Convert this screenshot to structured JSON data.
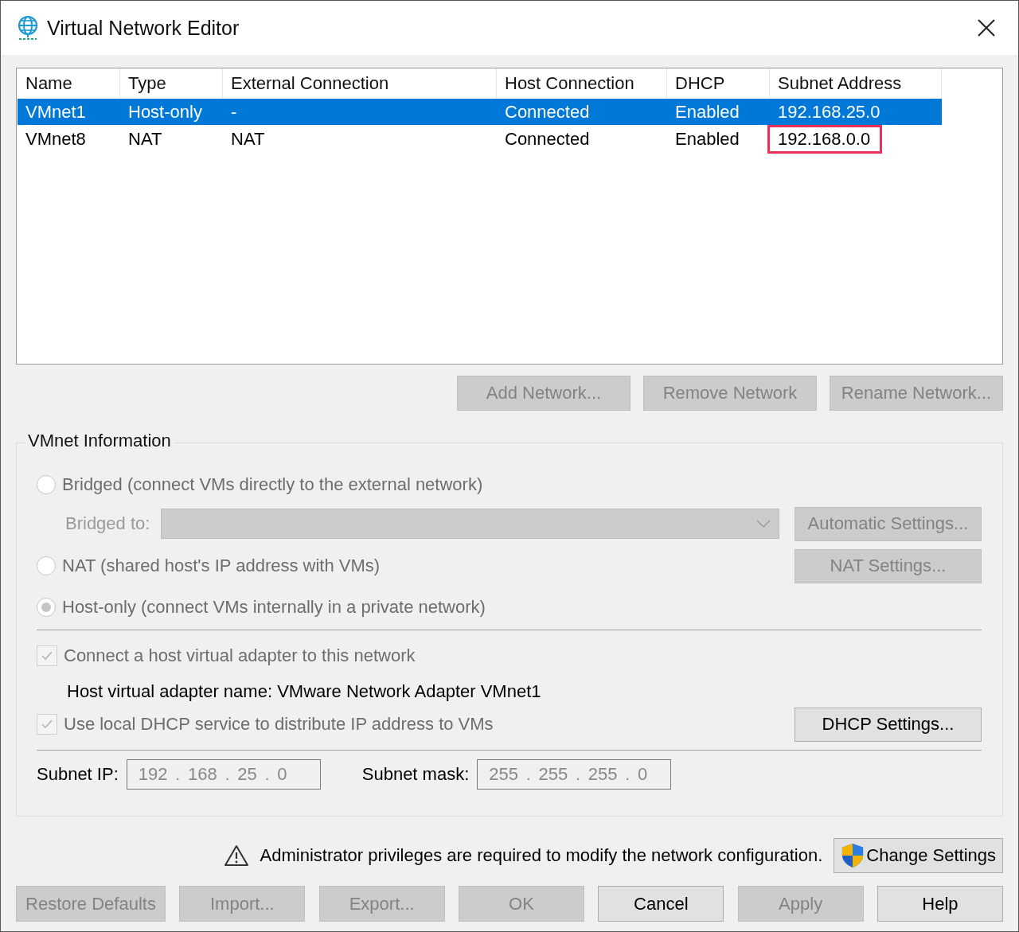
{
  "window": {
    "title": "Virtual Network Editor"
  },
  "table": {
    "columns": [
      "Name",
      "Type",
      "External Connection",
      "Host Connection",
      "DHCP",
      "Subnet Address"
    ],
    "rows": [
      {
        "selected": true,
        "cells": [
          {
            "text": "VMnet1",
            "highlighted": false
          },
          {
            "text": "Host-only",
            "highlighted": false
          },
          {
            "text": "-",
            "highlighted": false
          },
          {
            "text": "Connected",
            "highlighted": false
          },
          {
            "text": "Enabled",
            "highlighted": false
          },
          {
            "text": "192.168.25.0",
            "highlighted": false
          }
        ]
      },
      {
        "selected": false,
        "cells": [
          {
            "text": "VMnet8",
            "highlighted": false
          },
          {
            "text": "NAT",
            "highlighted": false
          },
          {
            "text": "NAT",
            "highlighted": false
          },
          {
            "text": "Connected",
            "highlighted": false
          },
          {
            "text": "Enabled",
            "highlighted": false
          },
          {
            "text": "192.168.0.0",
            "highlighted": true
          }
        ]
      }
    ]
  },
  "network_buttons": [
    {
      "label": "Add Network...",
      "disabled": true
    },
    {
      "label": "Remove Network",
      "disabled": true
    },
    {
      "label": "Rename Network...",
      "disabled": true
    }
  ],
  "vmnet_information": {
    "title": "VMnet Information",
    "options": [
      {
        "kind": "radio",
        "label": "Bridged (connect VMs directly to the external network)",
        "selected": false,
        "disabled": true
      },
      {
        "kind": "dropdown",
        "label": "Bridged to:",
        "disabled": true,
        "button": {
          "label": "Automatic Settings...",
          "disabled": true
        }
      },
      {
        "kind": "radio",
        "label": "NAT (shared host's IP address with VMs)",
        "selected": false,
        "disabled": true,
        "button": {
          "label": "NAT Settings...",
          "disabled": true
        }
      },
      {
        "kind": "radio",
        "label": "Host-only (connect VMs internally in a private network)",
        "selected": true,
        "disabled": true
      },
      {
        "kind": "separator"
      },
      {
        "kind": "checkbox",
        "label": "Connect a host virtual adapter to this network",
        "checked": true,
        "disabled": true
      },
      {
        "kind": "text",
        "label": "Host virtual adapter name: VMware Network Adapter VMnet1"
      },
      {
        "kind": "checkbox",
        "label": "Use local DHCP service to distribute IP address to VMs",
        "checked": true,
        "disabled": true,
        "button": {
          "label": "DHCP Settings...",
          "disabled": false
        }
      },
      {
        "kind": "separator"
      }
    ],
    "subnet_ip": {
      "label": "Subnet IP:",
      "octets": [
        "192",
        "168",
        "25",
        "0"
      ],
      "separator": "."
    },
    "subnet_mask": {
      "label": "Subnet mask:",
      "octets": [
        "255",
        "255",
        "255",
        "0"
      ],
      "separator": "."
    }
  },
  "notice": {
    "text": "Administrator privileges are required to modify the network configuration.",
    "button": {
      "label": "Change Settings",
      "disabled": false
    }
  },
  "footer_buttons": [
    {
      "label": "Restore Defaults",
      "disabled": true
    },
    {
      "label": "Import...",
      "disabled": true
    },
    {
      "label": "Export...",
      "disabled": true
    },
    {
      "label": "OK",
      "disabled": true
    },
    {
      "label": "Cancel",
      "disabled": false
    },
    {
      "label": "Apply",
      "disabled": true
    },
    {
      "label": "Help",
      "disabled": false
    }
  ]
}
